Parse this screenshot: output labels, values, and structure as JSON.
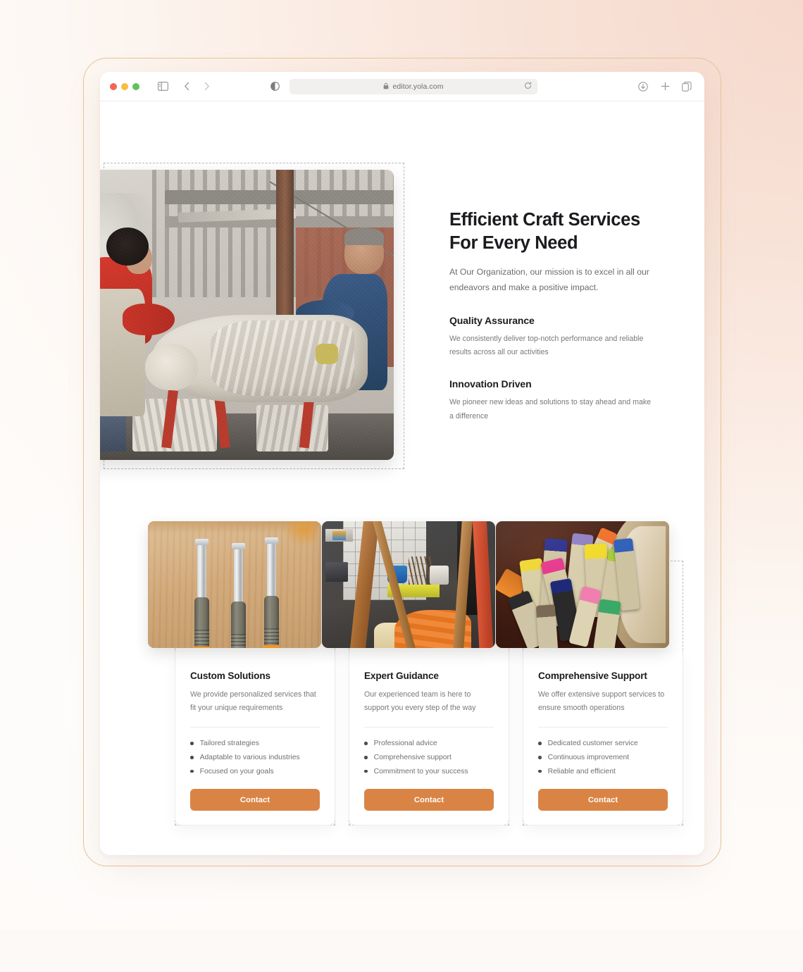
{
  "browser": {
    "url": "editor.yola.com",
    "icons": {
      "lock": "lock-icon",
      "reload": "reload-icon",
      "sidebar": "sidebar-toggle-icon",
      "back": "back-chevron-icon",
      "forward": "forward-chevron-icon",
      "reader": "reader-view-icon",
      "download": "download-icon",
      "new_tab": "plus-icon",
      "tabs": "tab-overview-icon"
    },
    "traffic_lights": {
      "close": "#f4655a",
      "minimize": "#f8bd3f",
      "maximize": "#5ec45a"
    }
  },
  "theme": {
    "accent": "#d98445",
    "heading": "#1b1b1f",
    "body_text": "#79797f",
    "page_bg": "#ffffff",
    "frame_line": "#e8c49a",
    "selection_dash": "#bdbdbd"
  },
  "hero": {
    "title": "Efficient Craft Services\nFor Every Need",
    "subtitle": "At Our Organization, our mission is to excel in all our endeavors and make a positive impact.",
    "image_alt": "Two stone masons restoring a carved stone statue in an outdoor workshop",
    "features": [
      {
        "title": "Quality Assurance",
        "text": "We consistently deliver top-notch performance and reliable results across all our activities"
      },
      {
        "title": "Innovation Driven",
        "text": "We pioneer new ideas and solutions to stay ahead and make a difference"
      }
    ]
  },
  "cards": [
    {
      "title": "Custom Solutions",
      "desc": "We provide personalized services that fit your unique requirements",
      "image_alt": "Three wood chisels with orange ferrules laid on a wooden board",
      "items": [
        "Tailored strategies",
        "Adaptable to various industries",
        "Focused on your goals"
      ],
      "button": "Contact"
    },
    {
      "title": "Expert Guidance",
      "desc": "Our experienced team is here to support you every step of the way",
      "image_alt": "Craft workshop interior with orange fabric, paint buckets and tools",
      "items": [
        "Professional advice",
        "Comprehensive support",
        "Commitment to your success"
      ],
      "button": "Contact"
    },
    {
      "title": "Comprehensive Support",
      "desc": "We offer extensive support services to ensure smooth operations",
      "image_alt": "Colorful wax crayons gathered inside a woven basket",
      "items": [
        "Dedicated customer service",
        "Continuous improvement",
        "Reliable and efficient"
      ],
      "button": "Contact"
    }
  ]
}
